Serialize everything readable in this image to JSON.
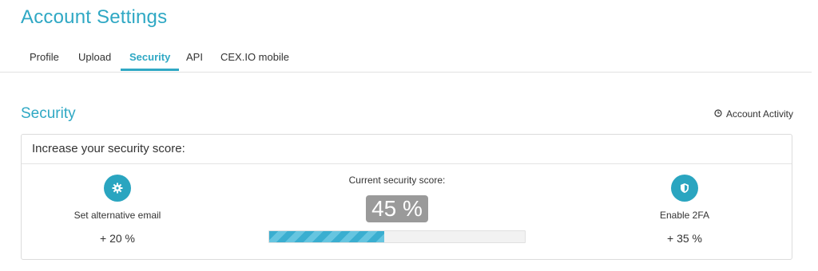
{
  "page": {
    "title": "Account Settings"
  },
  "tabs": [
    {
      "label": "Profile",
      "active": false
    },
    {
      "label": "Upload",
      "active": false
    },
    {
      "label": "Security",
      "active": true
    },
    {
      "label": "API",
      "active": false
    },
    {
      "label": "CEX.IO mobile",
      "active": false
    }
  ],
  "section": {
    "title": "Security",
    "account_activity_label": "Account Activity",
    "account_activity_icon": "clock-icon"
  },
  "card": {
    "header": "Increase your security score:",
    "left": {
      "icon": "gear-icon",
      "label": "Set alternative email",
      "pct": "+ 20 %"
    },
    "center": {
      "label": "Current security score:",
      "score_text": "45 %",
      "progress": 0.45
    },
    "right": {
      "icon": "shield-icon",
      "label": "Enable 2FA",
      "pct": "+ 35 %"
    }
  },
  "colors": {
    "accent": "#2fa8c4",
    "badge": "#9a9a9a",
    "progress_stripe": "#3aaed0"
  }
}
